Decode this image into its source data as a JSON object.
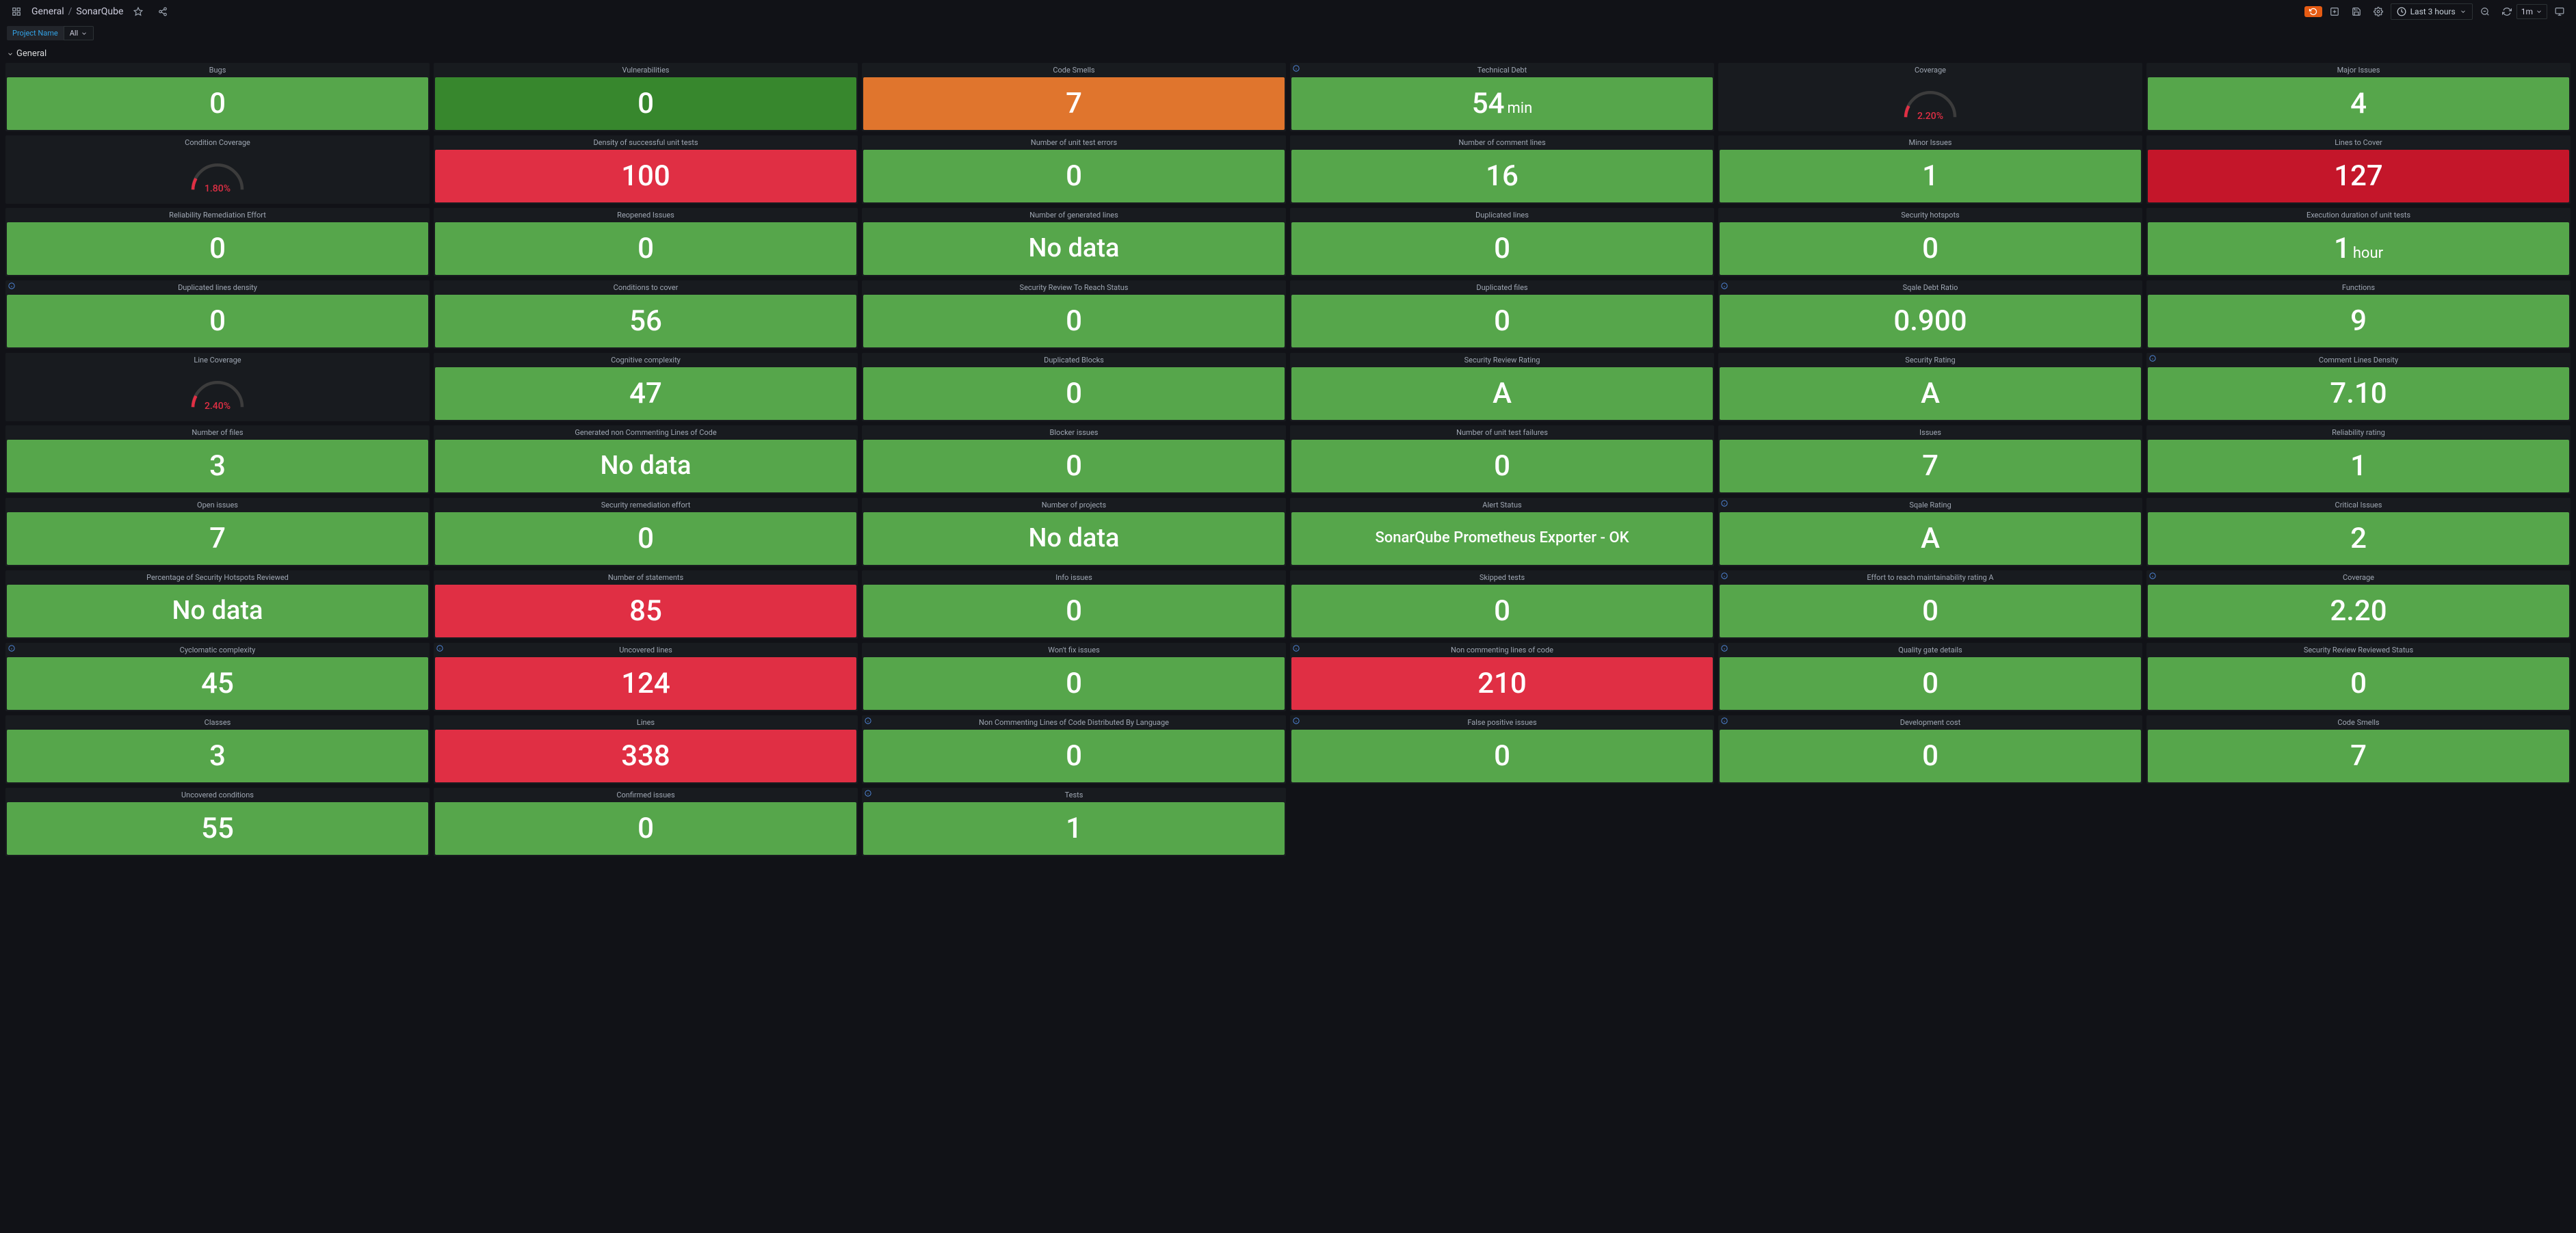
{
  "header": {
    "breadcrumb_root": "General",
    "breadcrumb_current": "SonarQube",
    "time_range": "Last 3 hours",
    "refresh_interval": "1m",
    "cycle_badge": "⟳"
  },
  "variables": {
    "label": "Project Name",
    "value": "All"
  },
  "row_title": "General",
  "panels": [
    {
      "title": "Bugs",
      "value": "0",
      "color": "green"
    },
    {
      "title": "Vulnerabilities",
      "value": "0",
      "color": "darkgreen"
    },
    {
      "title": "Code Smells",
      "value": "7",
      "color": "orange"
    },
    {
      "title": "Technical Debt",
      "value": "54",
      "unit": "min",
      "color": "green",
      "info": true
    },
    {
      "title": "Coverage",
      "type": "gauge",
      "gauge_value": "2.20%",
      "gauge_color": "red"
    },
    {
      "title": "Major Issues",
      "value": "4",
      "color": "green"
    },
    {
      "title": "Condition Coverage",
      "type": "gauge",
      "gauge_value": "1.80%",
      "gauge_color": "red"
    },
    {
      "title": "Density of successful unit tests",
      "value": "100",
      "color": "red"
    },
    {
      "title": "Number of unit test errors",
      "value": "0",
      "color": "green"
    },
    {
      "title": "Number of comment lines",
      "value": "16",
      "color": "green"
    },
    {
      "title": "Minor Issues",
      "value": "1",
      "color": "green"
    },
    {
      "title": "Lines to Cover",
      "value": "127",
      "color": "redpink"
    },
    {
      "title": "Reliability Remediation Effort",
      "value": "0",
      "color": "green"
    },
    {
      "title": "Reopened Issues",
      "value": "0",
      "color": "green"
    },
    {
      "title": "Number of generated lines",
      "value": "No data",
      "color": "green",
      "text": true
    },
    {
      "title": "Duplicated lines",
      "value": "0",
      "color": "green"
    },
    {
      "title": "Security hotspots",
      "value": "0",
      "color": "green"
    },
    {
      "title": "Execution duration of unit tests",
      "value": "1",
      "unit": "hour",
      "color": "green"
    },
    {
      "title": "Duplicated lines density",
      "value": "0",
      "color": "green",
      "info": true
    },
    {
      "title": "Conditions to cover",
      "value": "56",
      "color": "green"
    },
    {
      "title": "Security Review To Reach Status",
      "value": "0",
      "color": "green"
    },
    {
      "title": "Duplicated files",
      "value": "0",
      "color": "green"
    },
    {
      "title": "Sqale Debt Ratio",
      "value": "0.900",
      "color": "green",
      "info": true
    },
    {
      "title": "Functions",
      "value": "9",
      "color": "green"
    },
    {
      "title": "Line Coverage",
      "type": "gauge",
      "gauge_value": "2.40%",
      "gauge_color": "red"
    },
    {
      "title": "Cognitive complexity",
      "value": "47",
      "color": "green"
    },
    {
      "title": "Duplicated Blocks",
      "value": "0",
      "color": "green"
    },
    {
      "title": "Security Review Rating",
      "value": "A",
      "color": "green"
    },
    {
      "title": "Security Rating",
      "value": "A",
      "color": "green"
    },
    {
      "title": "Comment Lines Density",
      "value": "7.10",
      "color": "green",
      "info": true
    },
    {
      "title": "Number of files",
      "value": "3",
      "color": "green"
    },
    {
      "title": "Generated non Commenting Lines of Code",
      "value": "No data",
      "color": "green",
      "text": true
    },
    {
      "title": "Blocker issues",
      "value": "0",
      "color": "green"
    },
    {
      "title": "Number of unit test failures",
      "value": "0",
      "color": "green"
    },
    {
      "title": "Issues",
      "value": "7",
      "color": "green"
    },
    {
      "title": "Reliability rating",
      "value": "1",
      "color": "green"
    },
    {
      "title": "Open issues",
      "value": "7",
      "color": "green"
    },
    {
      "title": "Security remediation effort",
      "value": "0",
      "color": "green"
    },
    {
      "title": "Number of projects",
      "value": "No data",
      "color": "green",
      "text": true
    },
    {
      "title": "Alert Status",
      "value": "SonarQube Prometheus Exporter - OK",
      "color": "green",
      "text": true,
      "small": true
    },
    {
      "title": "Sqale Rating",
      "value": "A",
      "color": "green",
      "info": true
    },
    {
      "title": "Critical Issues",
      "value": "2",
      "color": "green"
    },
    {
      "title": "Percentage of Security Hotspots Reviewed",
      "value": "No data",
      "color": "green",
      "text": true
    },
    {
      "title": "Number of statements",
      "value": "85",
      "color": "red"
    },
    {
      "title": "Info issues",
      "value": "0",
      "color": "green"
    },
    {
      "title": "Skipped tests",
      "value": "0",
      "color": "green"
    },
    {
      "title": "Effort to reach maintainability rating A",
      "value": "0",
      "color": "green",
      "info": true
    },
    {
      "title": "Coverage",
      "value": "2.20",
      "color": "green",
      "info": true
    },
    {
      "title": "Cyclomatic complexity",
      "value": "45",
      "color": "green",
      "info": true
    },
    {
      "title": "Uncovered lines",
      "value": "124",
      "color": "red",
      "info": true
    },
    {
      "title": "Won't fix issues",
      "value": "0",
      "color": "green"
    },
    {
      "title": "Non commenting lines of code",
      "value": "210",
      "color": "red",
      "info": true
    },
    {
      "title": "Quality gate details",
      "value": "0",
      "color": "green",
      "info": true
    },
    {
      "title": "Security Review Reviewed Status",
      "value": "0",
      "color": "green"
    },
    {
      "title": "Classes",
      "value": "3",
      "color": "green"
    },
    {
      "title": "Lines",
      "value": "338",
      "color": "red"
    },
    {
      "title": "Non Commenting Lines of Code Distributed By Language",
      "value": "0",
      "color": "green",
      "info": true
    },
    {
      "title": "False positive issues",
      "value": "0",
      "color": "green",
      "info": true
    },
    {
      "title": "Development cost",
      "value": "0",
      "color": "green",
      "info": true
    },
    {
      "title": "Code Smells",
      "value": "7",
      "color": "green"
    },
    {
      "title": "Uncovered conditions",
      "value": "55",
      "color": "green"
    },
    {
      "title": "Confirmed issues",
      "value": "0",
      "color": "green"
    },
    {
      "title": "Tests",
      "value": "1",
      "color": "green",
      "info": true
    }
  ]
}
